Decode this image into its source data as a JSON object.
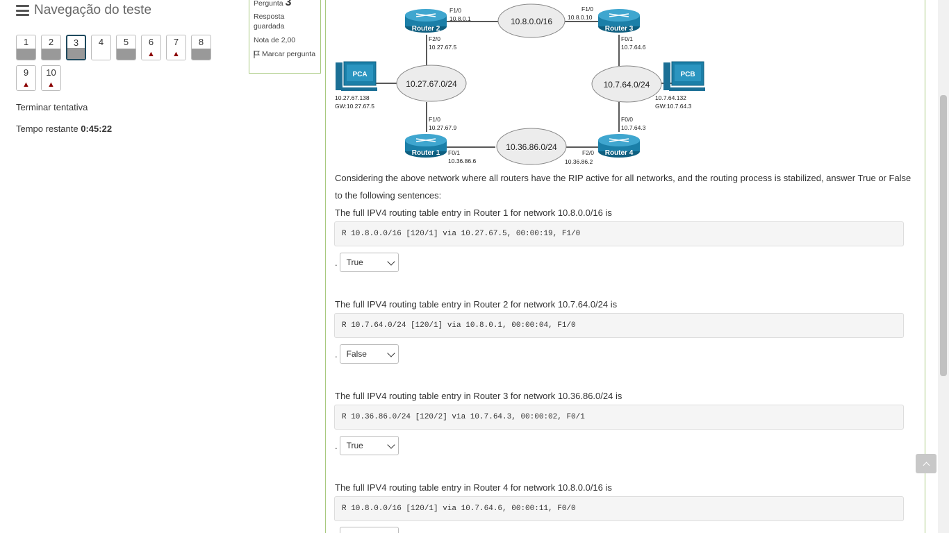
{
  "nav": {
    "title": "Navegação do teste",
    "questions": [
      {
        "n": "1",
        "state": "answered"
      },
      {
        "n": "2",
        "state": "answered"
      },
      {
        "n": "3",
        "state": "current"
      },
      {
        "n": "4",
        "state": "unanswered"
      },
      {
        "n": "5",
        "state": "answered"
      },
      {
        "n": "6",
        "state": "flagged"
      },
      {
        "n": "7",
        "state": "flagged"
      },
      {
        "n": "8",
        "state": "answered"
      },
      {
        "n": "9",
        "state": "flagged"
      },
      {
        "n": "10",
        "state": "flagged"
      }
    ],
    "finish_link": "Terminar tentativa",
    "timer_label": "Tempo restante",
    "timer_value": "0:45:22"
  },
  "info": {
    "question_label": "Pergunta",
    "question_number": "3",
    "status": "Resposta guardada",
    "grade": "Nota de 2,00",
    "flag_label": "Marcar pergunta"
  },
  "diagram": {
    "routers": [
      "Router 2",
      "Router 3",
      "Router 1",
      "Router 4"
    ],
    "pcs": [
      "PCA",
      "PCB"
    ],
    "networks": [
      "10.8.0.0/16",
      "10.27.67.0/24",
      "10.7.64.0/24",
      "10.36.86.0/24"
    ],
    "labels": {
      "r2_f10": "F1/0",
      "r2_f10_ip": "10.8.0.1",
      "r3_f10": "F1/0",
      "r3_f10_ip": "10.8.0.10",
      "r2_f20": "F2/0",
      "r2_f20_ip": "10.27.67.5",
      "r3_f01": "F0/1",
      "r3_f01_ip": "10.7.64.6",
      "pca_ip": "10.27.67.138",
      "pca_gw": "GW:10.27.67.5",
      "pcb_ip": "10.7.64.132",
      "pcb_gw": "GW:10.7.64.3",
      "r1_f10": "F1/0",
      "r1_f10_ip": "10.27.67.9",
      "r4_f00": "F0/0",
      "r4_f00_ip": "10.7.64.3",
      "r1_f01": "F0/1",
      "r1_f01_ip": "10.36.86.6",
      "r4_f20": "F2/0",
      "r4_f20_ip": "10.36.86.2"
    }
  },
  "question": {
    "intro": "Considering the above network where all routers have the RIP active for all networks, and the routing process is stabilized, answer True or False to the following sentences:",
    "items": [
      {
        "text": "The full IPV4 routing table entry in Router 1 for network 10.8.0.0/16 is",
        "code": "R 10.8.0.0/16 [120/1] via 10.27.67.5, 00:00:19, F1/0",
        "answer": "True"
      },
      {
        "text": "The full IPV4 routing table entry in Router 2 for network 10.7.64.0/24 is",
        "code": "R 10.7.64.0/24 [120/1] via 10.8.0.1, 00:00:04, F1/0",
        "answer": "False"
      },
      {
        "text": "The full IPV4 routing table entry in Router 3 for network 10.36.86.0/24 is",
        "code": "R 10.36.86.0/24 [120/2] via 10.7.64.3, 00:00:02, F0/1",
        "answer": "True"
      },
      {
        "text": "The full IPV4 routing table entry in Router 4 for network 10.8.0.0/16 is",
        "code": "R 10.8.0.0/16 [120/1] via 10.7.64.6, 00:00:11, F0/0",
        "answer": ""
      }
    ],
    "answer_prefix": "."
  },
  "colors": {
    "router": "#1b7fa8",
    "border_green": "#a8c97f",
    "flag_red": "#8b0000"
  }
}
